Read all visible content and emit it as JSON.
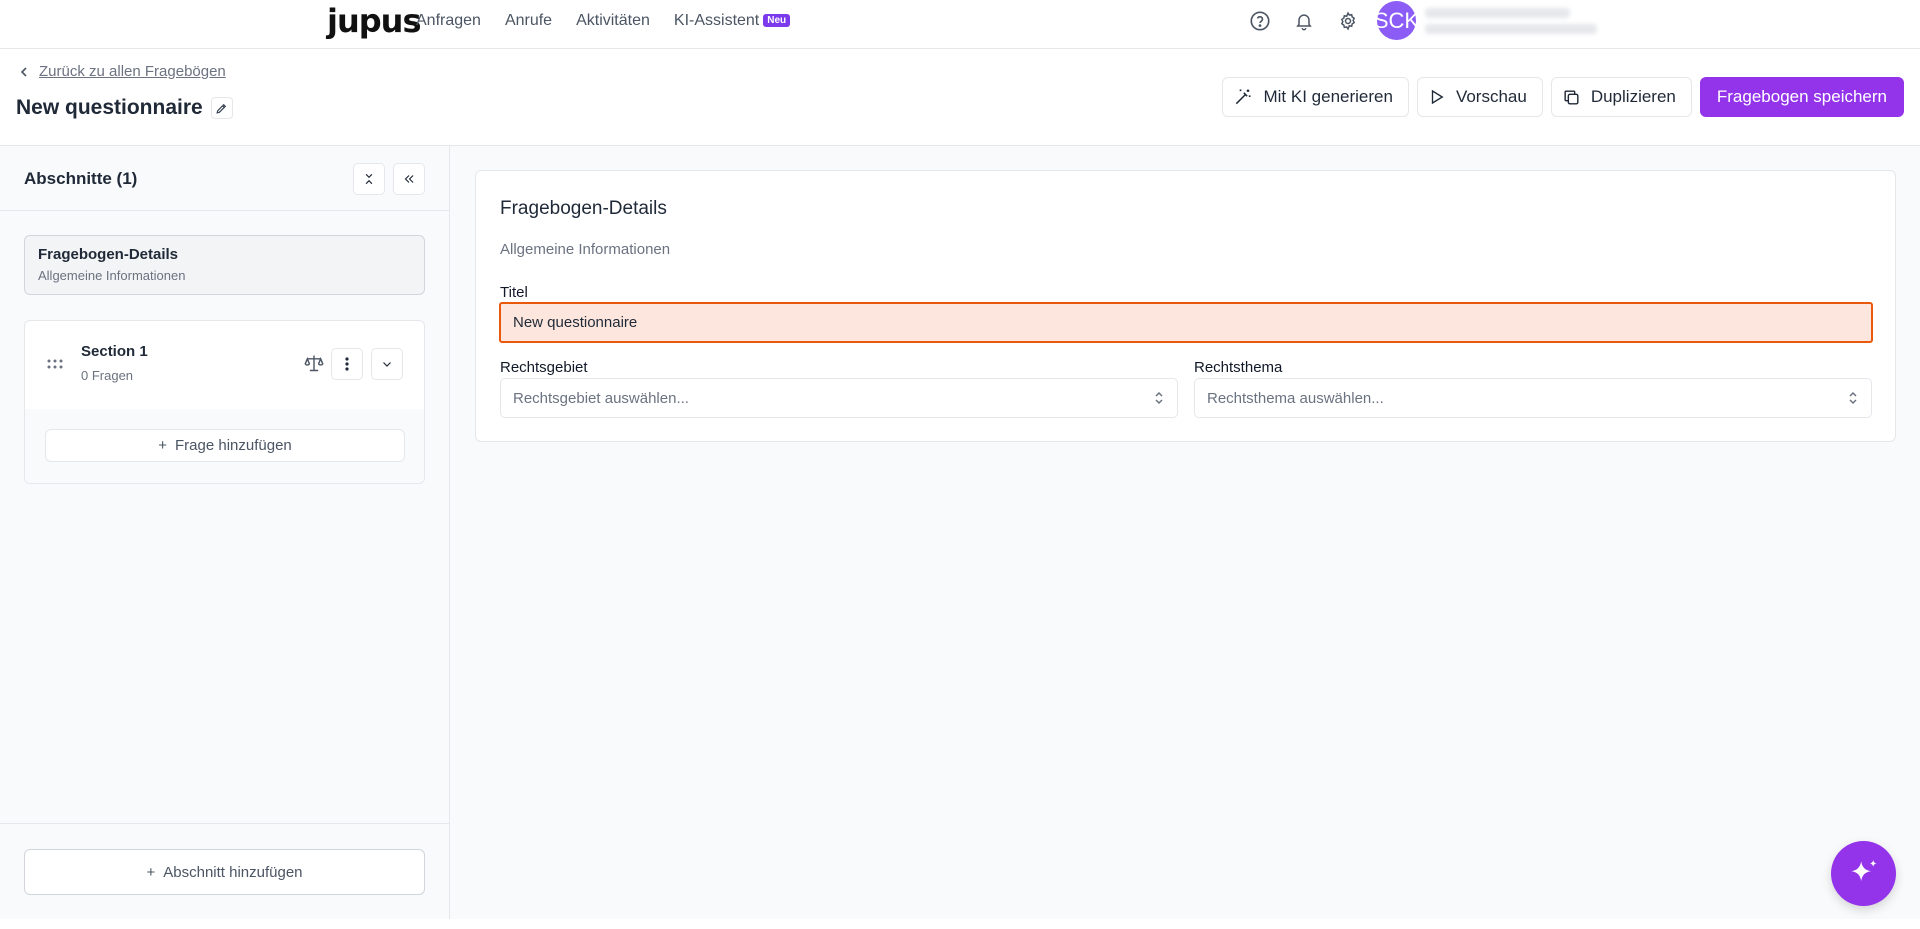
{
  "nav": {
    "logo": "jupus",
    "links": [
      "Anfragen",
      "Anrufe",
      "Aktivitäten",
      "KI-Assistent"
    ],
    "badge": "Neu",
    "avatar_initials": "SCK",
    "icons": [
      "help-icon",
      "bell-icon",
      "gear-icon"
    ]
  },
  "header": {
    "back_link": "Zurück zu allen Fragebögen",
    "title": "New questionnaire",
    "actions": {
      "generate": "Mit KI generieren",
      "preview": "Vorschau",
      "duplicate": "Duplizieren",
      "save": "Fragebogen speichern"
    }
  },
  "sidebar": {
    "title": "Abschnitte (1)",
    "details_card": {
      "title": "Fragebogen-Details",
      "subtitle": "Allgemeine Informationen"
    },
    "sections": [
      {
        "name": "Section 1",
        "count": "0 Fragen",
        "add_question": "Frage hinzufügen"
      }
    ],
    "add_section": "Abschnitt hinzufügen"
  },
  "main": {
    "card_title": "Fragebogen-Details",
    "card_subtitle": "Allgemeine Informationen",
    "title_label": "Titel",
    "title_value": "New questionnaire",
    "rechtsgebiet_label": "Rechtsgebiet",
    "rechtsgebiet_placeholder": "Rechtsgebiet auswählen...",
    "rechtsthema_label": "Rechtsthema",
    "rechtsthema_placeholder": "Rechtsthema auswählen..."
  },
  "colors": {
    "accent": "#9333ea",
    "error_border": "#ea580c",
    "error_fill": "#fde6dd"
  }
}
